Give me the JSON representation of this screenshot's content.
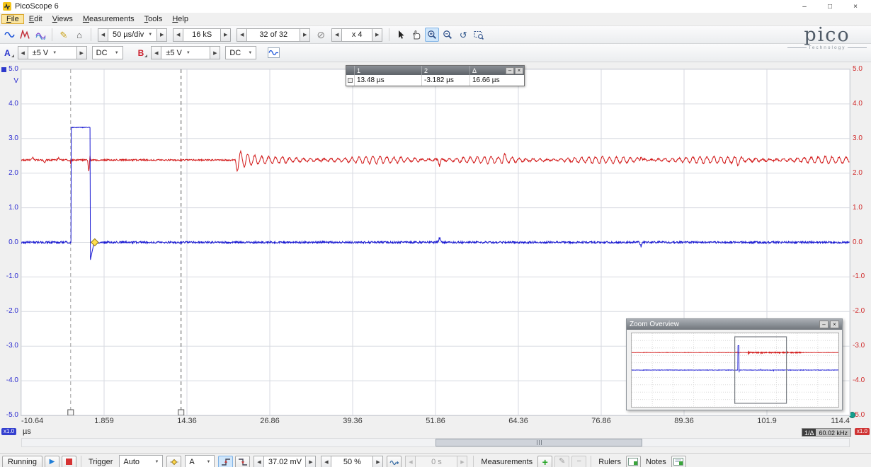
{
  "window": {
    "title": "PicoScope 6"
  },
  "menu": {
    "items": [
      "File",
      "Edit",
      "Views",
      "Measurements",
      "Tools",
      "Help"
    ]
  },
  "toolbar": {
    "timebase": "50 µs/div",
    "samples": "16 kS",
    "buffer": "32 of 32",
    "zoom": "x 4"
  },
  "logo": {
    "name": "pico",
    "tagline": "Technology"
  },
  "channels": {
    "a": {
      "label": "A",
      "range": "±5 V",
      "coupling": "DC"
    },
    "b": {
      "label": "B",
      "range": "±5 V",
      "coupling": "DC"
    }
  },
  "ruler_legend": {
    "columns": [
      "1",
      "2",
      "Δ"
    ],
    "values": [
      "13.48 µs",
      "-3.182 µs",
      "16.66 µs"
    ]
  },
  "zoom_overview": {
    "title": "Zoom Overview"
  },
  "freq_badge": {
    "label": "1/Δ",
    "value": "60.02 kHz"
  },
  "scale_badges": {
    "left": "x1.0",
    "right": "x1.0"
  },
  "bottom": {
    "running": "Running",
    "trigger_label": "Trigger",
    "trigger_mode": "Auto",
    "trigger_source": "A",
    "trigger_level": "37.02 mV",
    "pre_trigger": "50 %",
    "holdoff": "0 s",
    "measurements_label": "Measurements",
    "rulers_label": "Rulers",
    "notes_label": "Notes"
  },
  "icons": {
    "minimize": "–",
    "maximize": "□",
    "close": "×",
    "left": "◀",
    "right": "▶",
    "down": "▼",
    "pencil": "✎",
    "home": "⌂",
    "buffer_overview": "⊘",
    "undo_zoom": "↺",
    "add": "+",
    "edit": "✎",
    "remove": "−",
    "play": "▶"
  },
  "chart_data": {
    "type": "line",
    "title": "",
    "x_unit": "µs",
    "y_unit": "V",
    "x_range": [
      -10.64,
      114.4
    ],
    "x_full_range": [
      -260,
      240
    ],
    "y_range": [
      -5,
      5
    ],
    "x_ticks": [
      "-10.64",
      "1.859",
      "14.36",
      "26.86",
      "39.36",
      "51.86",
      "64.36",
      "76.86",
      "89.36",
      "101.9",
      "114.4"
    ],
    "y_ticks": [
      "5.0",
      "4.0",
      "3.0",
      "2.0",
      "1.0",
      "0.0",
      "-1.0",
      "-2.0",
      "-3.0",
      "-4.0",
      "-5.0"
    ],
    "grid_divisions": [
      10,
      10
    ],
    "series": [
      {
        "name": "Channel A",
        "color": "#1818d2",
        "baseline": 0.0,
        "noise_amp": 0.03,
        "pulse": {
          "t_rise": -3.1,
          "t_fall": -0.25,
          "level": 3.32,
          "undershoot": -0.55,
          "t_recover": 0.35
        },
        "spikes": [
          {
            "t": 52.5,
            "amp": 0.14,
            "w": 0.25
          },
          {
            "t": 82.9,
            "amp": -0.12,
            "w": 0.25
          }
        ]
      },
      {
        "name": "Channel B",
        "color": "#d21818",
        "baseline": 2.38,
        "noise_amp": 0.022,
        "ringing": {
          "t_start": 21.7,
          "burst_amp": 0.32,
          "burst_decay": 1.3,
          "sustain_amp": 0.065,
          "period": 1.05,
          "t_end": 150
        },
        "spikes": [
          {
            "t": -8.9,
            "amp": 0.07,
            "w": 0.3
          },
          {
            "t": -7.1,
            "amp": -0.06,
            "w": 0.3
          },
          {
            "t": -5.0,
            "amp": 0.07,
            "w": 0.3
          },
          {
            "t": -3.15,
            "amp": -0.14,
            "w": 0.12
          },
          {
            "t": -0.45,
            "amp": -0.36,
            "w": 0.18
          },
          {
            "t": -0.27,
            "amp": 0.14,
            "w": 0.1
          },
          {
            "t": 52.5,
            "amp": -0.16,
            "w": 0.25
          },
          {
            "t": 62.3,
            "amp": 0.12,
            "w": 0.25
          },
          {
            "t": 82.9,
            "amp": 0.12,
            "w": 0.25
          },
          {
            "t": 97.5,
            "amp": -0.1,
            "w": 0.25
          }
        ]
      }
    ],
    "time_rulers": [
      {
        "id": "1",
        "t": 13.48
      },
      {
        "id": "2",
        "t": -3.182
      }
    ],
    "trigger_marker": {
      "t": 0.45,
      "v": 0.0
    },
    "zoom_factor": "x 4"
  }
}
